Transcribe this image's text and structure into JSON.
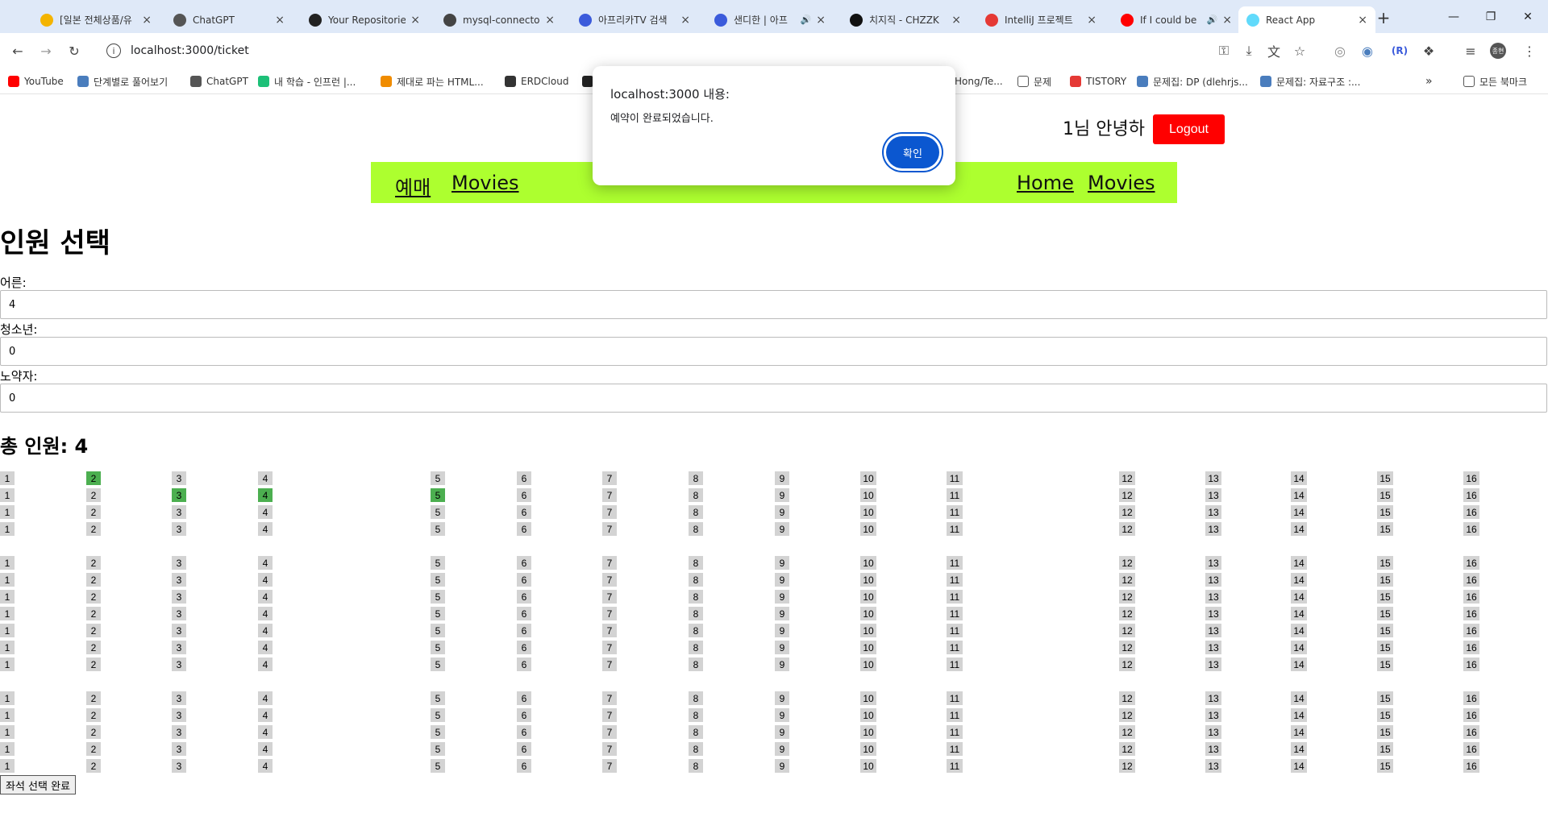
{
  "browser": {
    "tabs": [
      {
        "title": "[일본 전체상품/유",
        "color": "#f4b400",
        "audio": false
      },
      {
        "title": "ChatGPT",
        "color": "#555555",
        "audio": false
      },
      {
        "title": "Your Repositories",
        "color": "#222222",
        "audio": false
      },
      {
        "title": "mysql-connector",
        "color": "#444444",
        "audio": false
      },
      {
        "title": "아프리카TV 검색",
        "color": "#3b5bdb",
        "audio": false
      },
      {
        "title": "샌디한 | 아프",
        "color": "#3b5bdb",
        "audio": true
      },
      {
        "title": "치지직 - CHZZK",
        "color": "#111111",
        "audio": false
      },
      {
        "title": "IntelliJ 프로젝트",
        "color": "#e53935",
        "audio": false
      },
      {
        "title": "If I could be",
        "color": "#ff0000",
        "audio": true
      },
      {
        "title": "React App",
        "color": "#61dafb",
        "audio": false
      }
    ],
    "active_tab_index": 9,
    "url": "localhost:3000/ticket",
    "bookmarks": [
      {
        "label": "YouTube",
        "color": "#ff0000"
      },
      {
        "label": "단계별로 풀어보기",
        "color": "#4a7dbd"
      },
      {
        "label": "ChatGPT",
        "color": "#555555"
      },
      {
        "label": "내 학습 - 인프런 |...",
        "color": "#1dc078"
      },
      {
        "label": "제대로 파는 HTML...",
        "color": "#f08c00"
      },
      {
        "label": "ERDCloud",
        "color": "#333333"
      },
      {
        "label": "",
        "color": "#222222"
      },
      {
        "label": "Hong/Te...",
        "color": "#ffffff"
      },
      {
        "label": "문제",
        "color": "#ffffff"
      },
      {
        "label": "TISTORY",
        "color": "#e53935"
      },
      {
        "label": "문제집: DP (dlehrjs...",
        "color": "#4a7dbd"
      },
      {
        "label": "문제집: 자료구조 :...",
        "color": "#4a7dbd"
      }
    ],
    "all_bookmarks": "모든 북마크",
    "profile": "종현"
  },
  "header": {
    "greeting": "1님 안녕하",
    "logout_label": "Logout",
    "nav_left": [
      "예매",
      "Movies"
    ],
    "nav_right": [
      "Home",
      "Movies"
    ]
  },
  "main": {
    "title": "인원 선택",
    "fields": [
      {
        "label": "어른:",
        "value": "4"
      },
      {
        "label": "청소년:",
        "value": "0"
      },
      {
        "label": "노약자:",
        "value": "0"
      }
    ],
    "total_label": "총 인원: 4",
    "seat_numbers": [
      "1",
      "2",
      "3",
      "4",
      "5",
      "6",
      "7",
      "8",
      "9",
      "10",
      "11",
      "12",
      "13",
      "14",
      "15",
      "16"
    ],
    "seat_blocks_rows": [
      4,
      7,
      5
    ],
    "selected_seats": [
      {
        "row": 1,
        "seat": 2
      },
      {
        "row": 2,
        "seat": 3
      },
      {
        "row": 2,
        "seat": 4
      },
      {
        "row": 2,
        "seat": 5
      }
    ],
    "complete_label": "좌석 선택 완료"
  },
  "alert": {
    "title": "localhost:3000 내용:",
    "message": "예약이 완료되었습니다.",
    "ok_label": "확인"
  },
  "colors": {
    "navbar": "#adff2f",
    "logout": "#ff0000",
    "seat": "#d3d3d3",
    "seat_selected": "#4caf50",
    "alert_button": "#0b57d0"
  }
}
